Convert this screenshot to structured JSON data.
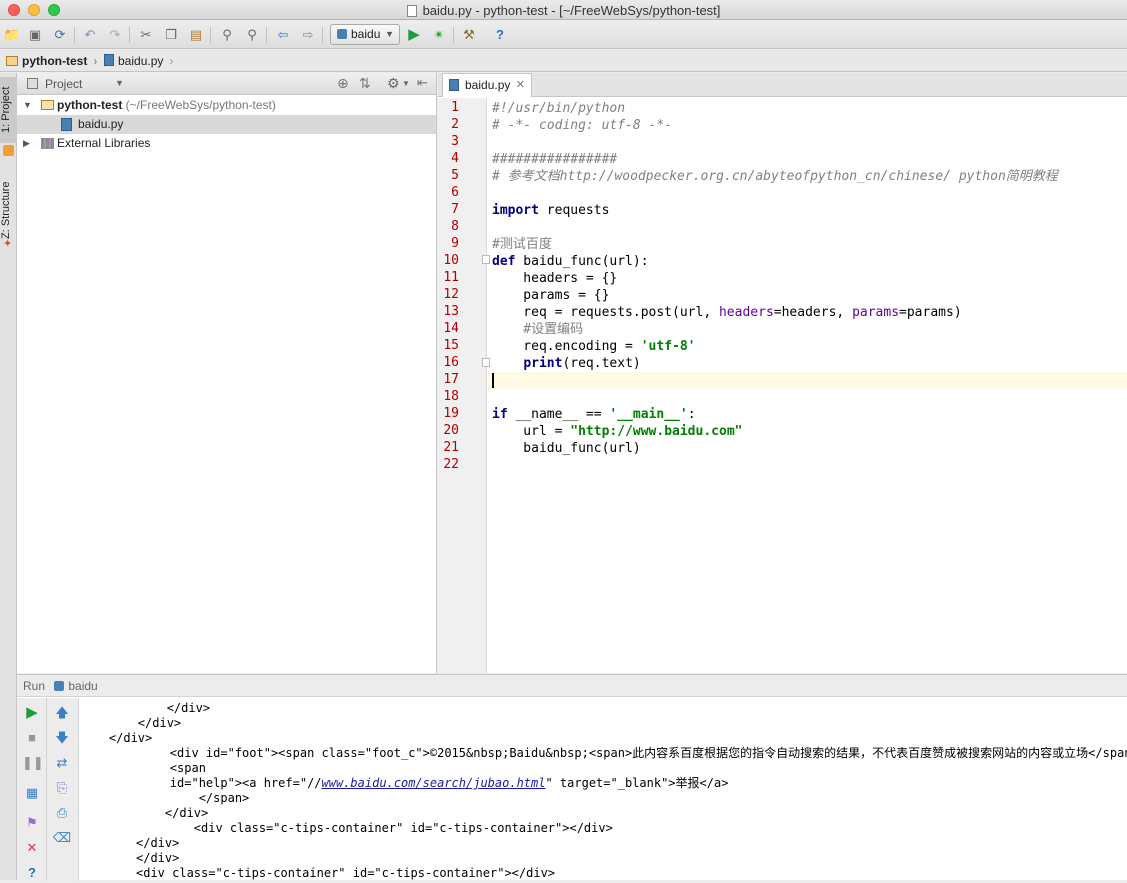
{
  "window": {
    "title": "baidu.py - python-test - [~/FreeWebSys/python-test]"
  },
  "toolbar": {
    "run_config": "baidu"
  },
  "navbar": {
    "crumbs": [
      "python-test",
      "baidu.py"
    ]
  },
  "left_strip": {
    "tabs": [
      "1: Project",
      "Z: Structure"
    ]
  },
  "project": {
    "header": "Project",
    "root": {
      "name": "python-test",
      "path": "(~/FreeWebSys/python-test)"
    },
    "file": "baidu.py",
    "libs": "External Libraries"
  },
  "editor": {
    "tab": "baidu.py",
    "line_numbers": [
      "1",
      "2",
      "3",
      "4",
      "5",
      "6",
      "7",
      "8",
      "9",
      "10",
      "11",
      "12",
      "13",
      "14",
      "15",
      "16",
      "17",
      "18",
      "19",
      "20",
      "21",
      "22"
    ],
    "lines": {
      "l1": "#!/usr/bin/python",
      "l2": "# -*- coding: utf-8 -*-",
      "l4": "################",
      "l5": "# 参考文档http://woodpecker.org.cn/abyteofpython_cn/chinese/ python简明教程",
      "l7a": "import",
      "l7b": " requests",
      "l9": "#测试百度",
      "l10a": "def",
      "l10b": " baidu_func(url):",
      "l11": "    headers = {}",
      "l12": "    params = {}",
      "l13a": "    req = requests.post(url, ",
      "l13b": "headers",
      "l13c": "=headers, ",
      "l13d": "params",
      "l13e": "=params)",
      "l14": "    #设置编码",
      "l15a": "    req.encoding = ",
      "l15b": "'utf-8'",
      "l16a": "    ",
      "l16b": "print",
      "l16c": "(req.text)",
      "l19a": "if",
      "l19b": " __name__ == ",
      "l19c": "'__main__'",
      "l19d": ":",
      "l20a": "    url = ",
      "l20b": "\"http://www.baidu.com\"",
      "l21": "    baidu_func(url)"
    }
  },
  "run": {
    "label": "Run",
    "config": "baidu",
    "output": {
      "o1": "            </div>",
      "o2": "        </div>",
      "o3": "    </div>",
      "o4": "        <div id=\"foot\"><span class=\"foot_c\">©2015&nbsp;Baidu&nbsp;<span>此内容系百度根据您的指令自动搜索的结果，不代表百度赞成被搜索网站的内容或立场</span><",
      "o5": "        <span",
      "o6a": "        id=\"help\"><a href=\"//",
      "o6b": "www.baidu.com/search/jubao.html",
      "o6c": "\" target=\"_blank\">举报</a>",
      "o7": "            </span>",
      "o8": "    </div>",
      "o9": "        <div class=\"c-tips-container\" id=\"c-tips-container\"></div>",
      "o10": "</div>",
      "o11": "</div>",
      "o12": "<div class=\"c-tips-container\" id=\"c-tips-container\"></div>"
    }
  },
  "colors": {
    "close": "#fc605c",
    "minimize": "#fdbc40",
    "zoom": "#34c84a",
    "line_number": "#b00000",
    "caret_line": "#fffae3"
  }
}
